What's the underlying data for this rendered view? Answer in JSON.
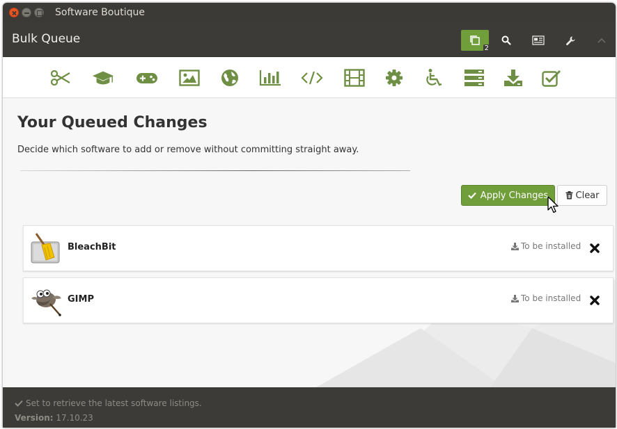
{
  "window": {
    "title": "Software Boutique"
  },
  "header": {
    "title": "Bulk Queue",
    "queue_count": "2",
    "buttons": [
      "queue-icon",
      "search-icon",
      "news-icon",
      "wrench-icon",
      "chevron-up-icon"
    ]
  },
  "categories": [
    {
      "name": "accessories",
      "icon": "scissors-icon"
    },
    {
      "name": "education",
      "icon": "graduation-cap-icon"
    },
    {
      "name": "games",
      "icon": "gamepad-icon"
    },
    {
      "name": "graphics",
      "icon": "image-icon"
    },
    {
      "name": "internet",
      "icon": "globe-icon"
    },
    {
      "name": "office",
      "icon": "bar-chart-icon"
    },
    {
      "name": "programming",
      "icon": "code-icon"
    },
    {
      "name": "sound-video",
      "icon": "film-icon"
    },
    {
      "name": "system-tools",
      "icon": "gear-icon"
    },
    {
      "name": "universal-access",
      "icon": "wheelchair-icon"
    },
    {
      "name": "servers",
      "icon": "server-icon"
    },
    {
      "name": "more-apps",
      "icon": "download-icon"
    },
    {
      "name": "installed",
      "icon": "checkbox-icon"
    }
  ],
  "main": {
    "title": "Your Queued Changes",
    "description": "Decide which software to add or remove without committing straight away.",
    "apply_label": "Apply Changes",
    "clear_label": "Clear"
  },
  "queue": [
    {
      "name": "BleachBit",
      "status": "To be installed",
      "icon": "bleachbit-icon"
    },
    {
      "name": "GIMP",
      "status": "To be installed",
      "icon": "gimp-icon"
    }
  ],
  "footer": {
    "status": "Set to retrieve the latest software listings.",
    "version_label": "Version:",
    "version": "17.10.23"
  },
  "colors": {
    "accent": "#6f9e3a",
    "headerbar": "#3c3b37",
    "close_button": "#e95420"
  }
}
